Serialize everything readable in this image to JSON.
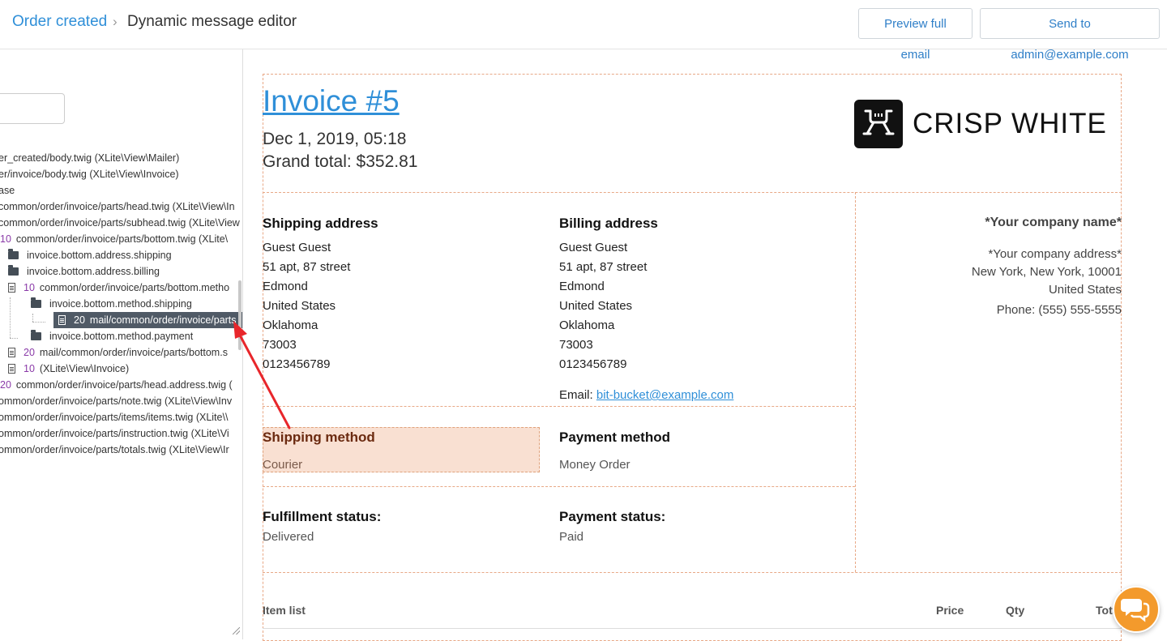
{
  "header": {
    "breadcrumb_link": "Order created",
    "breadcrumb_sep": "›",
    "breadcrumb_current": "Dynamic message editor",
    "preview_label": "Preview full email",
    "send_label": "Send to admin@example.com"
  },
  "sidebar": {
    "tree": [
      {
        "text": "er_created/body.twig (XLite\\View\\Mailer)",
        "num": "",
        "icon": "none"
      },
      {
        "text": "er/invoice/body.twig (XLite\\View\\Invoice)",
        "num": "",
        "icon": "none"
      },
      {
        "text": "ase",
        "num": "",
        "icon": "none"
      },
      {
        "text": "common/order/invoice/parts/head.twig (XLite\\View\\In",
        "num": "",
        "icon": "none"
      },
      {
        "text": "common/order/invoice/parts/subhead.twig (XLite\\View",
        "num": "",
        "icon": "none"
      },
      {
        "text": "common/order/invoice/parts/bottom.twig (XLite\\",
        "num": "10",
        "icon": "none"
      },
      {
        "text": "invoice.bottom.address.shipping",
        "num": "",
        "icon": "folder"
      },
      {
        "text": "invoice.bottom.address.billing",
        "num": "",
        "icon": "folder"
      },
      {
        "text": "common/order/invoice/parts/bottom.metho",
        "num": "10",
        "icon": "file"
      },
      {
        "text": "invoice.bottom.method.shipping",
        "num": "",
        "icon": "folder-open"
      },
      {
        "text": "mail/common/order/invoice/parts",
        "num": "20",
        "icon": "file"
      },
      {
        "text": "invoice.bottom.method.payment",
        "num": "",
        "icon": "folder"
      },
      {
        "text": "mail/common/order/invoice/parts/bottom.s",
        "num": "20",
        "icon": "file"
      },
      {
        "text": "(XLite\\View\\Invoice)",
        "num": "10",
        "icon": "file"
      },
      {
        "text": "common/order/invoice/parts/head.address.twig (",
        "num": "20",
        "icon": "none"
      },
      {
        "text": "ommon/order/invoice/parts/note.twig (XLite\\View\\Inv",
        "num": "",
        "icon": "none"
      },
      {
        "text": "ommon/order/invoice/parts/items/items.twig (XLite\\\\",
        "num": "",
        "icon": "none"
      },
      {
        "text": "ommon/order/invoice/parts/instruction.twig (XLite\\Vi",
        "num": "",
        "icon": "none"
      },
      {
        "text": "ommon/order/invoice/parts/totals.twig (XLite\\View\\Ir",
        "num": "",
        "icon": "none"
      }
    ]
  },
  "invoice": {
    "title": "Invoice #5",
    "date": "Dec 1, 2019, 05:18",
    "grand_total": "Grand total: $352.81",
    "logo_text": "CRISP WHITE",
    "shipping_address": {
      "heading": "Shipping address",
      "lines": [
        "Guest Guest",
        "51 apt, 87 street",
        "Edmond",
        "United States",
        "Oklahoma",
        "73003",
        "0123456789"
      ]
    },
    "billing_address": {
      "heading": "Billing address",
      "lines": [
        "Guest Guest",
        "51 apt, 87 street",
        "Edmond",
        "United States",
        "Oklahoma",
        "73003",
        "0123456789"
      ],
      "email_label": "Email:",
      "email": "bit-bucket@example.com"
    },
    "company": {
      "name": "*Your company name*",
      "address": "*Your company address*",
      "city": "New York, New York, 10001",
      "country": "United States",
      "phone": "Phone: (555) 555-5555"
    },
    "shipping_method": {
      "heading": "Shipping method",
      "value": "Courier"
    },
    "payment_method": {
      "heading": "Payment method",
      "value": "Money Order"
    },
    "fulfillment_status": {
      "heading": "Fulfillment status:",
      "value": "Delivered"
    },
    "payment_status": {
      "heading": "Payment status:",
      "value": "Paid"
    },
    "items_table": {
      "col_item": "Item list",
      "col_price": "Price",
      "col_qty": "Qty",
      "col_total": "Total"
    }
  },
  "colors": {
    "accent": "#2f8fd8",
    "highlight": "#f9e0d2",
    "border_dashed": "#e8a886",
    "arrow": "#e8262b",
    "chat": "#f39a2c"
  },
  "icons": {
    "chat": "chat-bubbles-icon",
    "folder": "folder-icon",
    "file": "file-icon"
  }
}
